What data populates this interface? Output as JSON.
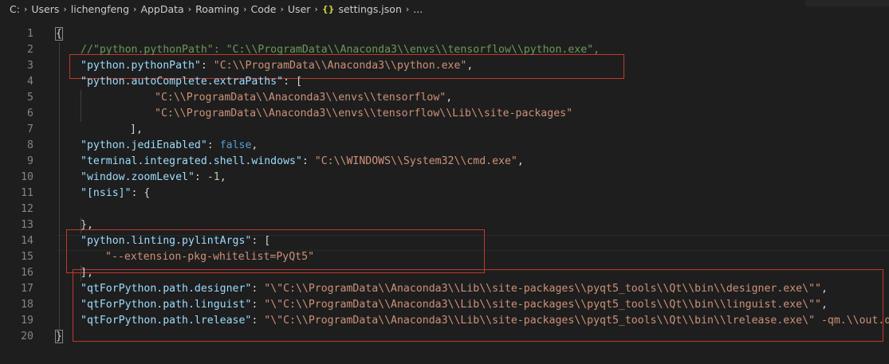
{
  "breadcrumb": {
    "items": [
      "C:",
      "Users",
      "lichengfeng",
      "AppData",
      "Roaming",
      "Code",
      "User"
    ],
    "file_icon": "{}",
    "file": "settings.json",
    "ellipsis": "..."
  },
  "editor": {
    "lines": [
      {
        "n": "1",
        "t": [
          [
            "p",
            "{"
          ]
        ]
      },
      {
        "n": "2",
        "t": [
          [
            "c",
            "//\"python.pythonPath\": \"C:\\\\ProgramData\\\\Anaconda3\\\\envs\\\\tensorflow\\\\python.exe\","
          ]
        ]
      },
      {
        "n": "3",
        "t": [
          [
            "k",
            "\"python.pythonPath\""
          ],
          [
            "p",
            ": "
          ],
          [
            "s",
            "\"C:\\\\ProgramData\\\\Anaconda3\\\\python.exe\""
          ],
          [
            "p",
            ","
          ]
        ]
      },
      {
        "n": "4",
        "t": [
          [
            "k",
            "\"python.autoComplete.extraPaths\""
          ],
          [
            "p",
            ": ["
          ]
        ]
      },
      {
        "n": "5",
        "t": [
          [
            "s",
            "\"C:\\\\ProgramData\\\\Anaconda3\\\\envs\\\\tensorflow\""
          ],
          [
            "p",
            ","
          ]
        ]
      },
      {
        "n": "6",
        "t": [
          [
            "s",
            "\"C:\\\\ProgramData\\\\Anaconda3\\\\envs\\\\tensorflow\\\\Lib\\\\site-packages\""
          ]
        ]
      },
      {
        "n": "7",
        "t": [
          [
            "p",
            "],"
          ]
        ]
      },
      {
        "n": "8",
        "t": [
          [
            "k",
            "\"python.jediEnabled\""
          ],
          [
            "p",
            ": "
          ],
          [
            "b",
            "false"
          ],
          [
            "p",
            ","
          ]
        ]
      },
      {
        "n": "9",
        "t": [
          [
            "k",
            "\"terminal.integrated.shell.windows\""
          ],
          [
            "p",
            ": "
          ],
          [
            "s",
            "\"C:\\\\WINDOWS\\\\System32\\\\cmd.exe\""
          ],
          [
            "p",
            ","
          ]
        ]
      },
      {
        "n": "10",
        "t": [
          [
            "k",
            "\"window.zoomLevel\""
          ],
          [
            "p",
            ": "
          ],
          [
            "n",
            "-1"
          ],
          [
            "p",
            ","
          ]
        ]
      },
      {
        "n": "11",
        "t": [
          [
            "k",
            "\"[nsis]\""
          ],
          [
            "p",
            ": {"
          ]
        ]
      },
      {
        "n": "12",
        "t": []
      },
      {
        "n": "13",
        "t": [
          [
            "p",
            "},"
          ]
        ]
      },
      {
        "n": "14",
        "t": [
          [
            "k",
            "\"python.linting.pylintArgs\""
          ],
          [
            "p",
            ": ["
          ]
        ]
      },
      {
        "n": "15",
        "t": [
          [
            "s",
            "\"--extension-pkg-whitelist=PyQt5\""
          ]
        ]
      },
      {
        "n": "16",
        "t": [
          [
            "p",
            "],"
          ]
        ]
      },
      {
        "n": "17",
        "t": [
          [
            "k",
            "\"qtForPython.path.designer\""
          ],
          [
            "p",
            ": "
          ],
          [
            "s",
            "\"\\\"C:\\\\ProgramData\\\\Anaconda3\\\\Lib\\\\site-packages\\\\pyqt5_tools\\\\Qt\\\\bin\\\\designer.exe\\\"\""
          ],
          [
            "p",
            ","
          ]
        ]
      },
      {
        "n": "18",
        "t": [
          [
            "k",
            "\"qtForPython.path.linguist\""
          ],
          [
            "p",
            ": "
          ],
          [
            "s",
            "\"\\\"C:\\\\ProgramData\\\\Anaconda3\\\\Lib\\\\site-packages\\\\pyqt5_tools\\\\Qt\\\\bin\\\\linguist.exe\\\"\""
          ],
          [
            "p",
            ","
          ]
        ]
      },
      {
        "n": "19",
        "t": [
          [
            "k",
            "\"qtForPython.path.lrelease\""
          ],
          [
            "p",
            ": "
          ],
          [
            "s",
            "\"\\\"C:\\\\ProgramData\\\\Anaconda3\\\\Lib\\\\site-packages\\\\pyqt5_tools\\\\Qt\\\\bin\\\\lrelease.exe\\\" -qm.\\\\out.q"
          ]
        ]
      },
      {
        "n": "20",
        "t": [
          [
            "p",
            "}"
          ]
        ]
      }
    ]
  },
  "colors": {
    "background": "#1e1e1e",
    "key": "#9cdcfe",
    "string": "#ce9178",
    "comment": "#6a9955",
    "number": "#b5cea8",
    "keyword": "#569cd6",
    "highlight_box": "#c0392b"
  },
  "icons": {
    "breadcrumb_separator": "chevron-right-icon",
    "json_file": "json-file-icon"
  }
}
